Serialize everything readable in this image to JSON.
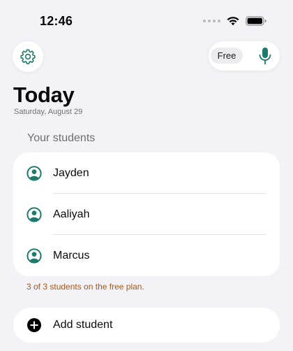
{
  "status_bar": {
    "time": "12:46"
  },
  "header": {
    "plan_badge": "Free",
    "title": "Today",
    "date": "Saturday, August 29"
  },
  "students_section": {
    "header": "Your students",
    "students": [
      {
        "name": "Jayden"
      },
      {
        "name": "Aaliyah"
      },
      {
        "name": "Marcus"
      }
    ],
    "plan_note": "3 of 3 students on the free plan."
  },
  "add_student": {
    "label": "Add student"
  },
  "icons": {
    "settings": "gear-icon",
    "mic": "microphone-icon",
    "student": "person-circle-icon",
    "add": "plus-circle-icon"
  },
  "colors": {
    "accent": "#1f7a6d",
    "background": "#f2f2f7",
    "card": "#ffffff",
    "warning_text": "#a5581e"
  }
}
